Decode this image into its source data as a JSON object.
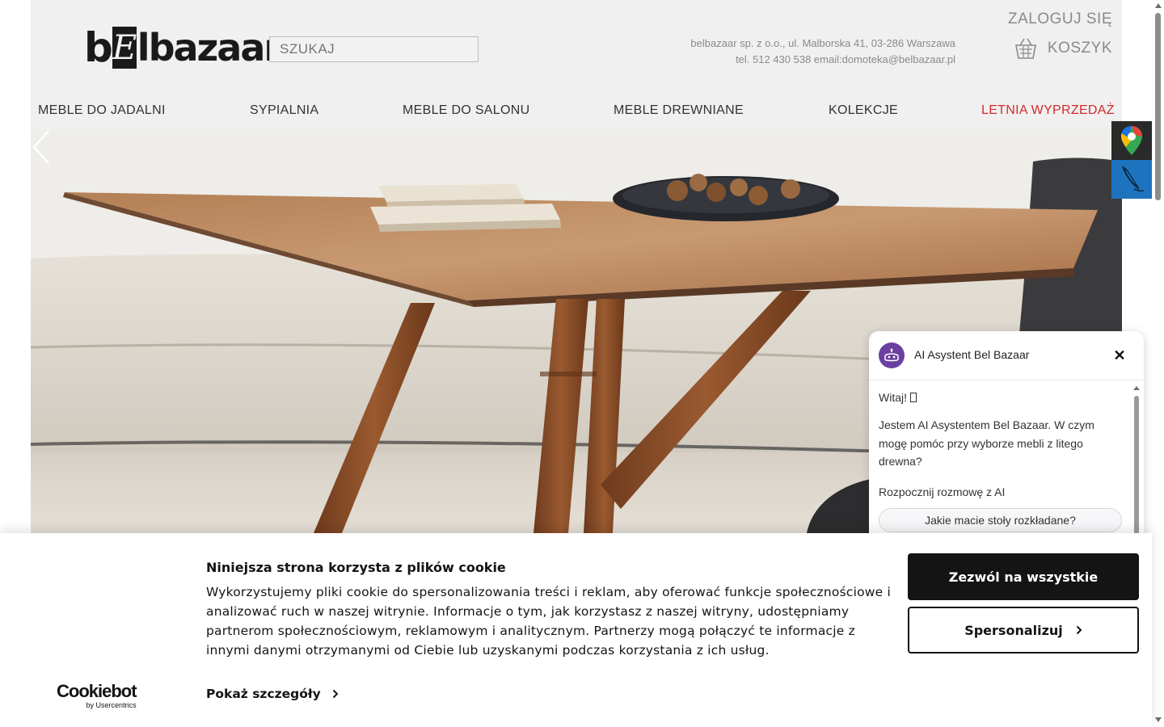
{
  "header": {
    "logo": {
      "b": "b",
      "e": "E",
      "rest": "lbazaar"
    },
    "search_placeholder": "SZUKAJ",
    "address_line1": "belbazaar sp. z o.o., ul. Malborska 41, 03-286 Warszawa",
    "address_line2": "tel. 512 430 538 email:domoteka@belbazaar.pl",
    "login": "ZALOGUJ SIĘ",
    "cart": "KOSZYK"
  },
  "nav": {
    "items": [
      {
        "label": "MEBLE DO JADALNI"
      },
      {
        "label": "SYPIALNIA"
      },
      {
        "label": "MEBLE DO SALONU"
      },
      {
        "label": "MEBLE DREWNIANE"
      },
      {
        "label": "KOLEKCJE"
      },
      {
        "label": "LETNIA WYPRZEDAŻ"
      }
    ]
  },
  "hero": {
    "prev_icon": "chevron-left-icon"
  },
  "side_widgets": {
    "map_icon": "google-maps-icon",
    "write_icon": "feather-pen-icon"
  },
  "chat": {
    "title": "AI Asystent Bel Bazaar",
    "close": "✕",
    "greeting": "Witaj! ",
    "message": "Jestem AI Asystentem Bel Bazaar. W czym mogę pomóc przy wyborze mebli z litego drewna?",
    "start": "Rozpocznij rozmowę z AI",
    "suggestion": "Jakie macie stoły rozkładane?"
  },
  "cookie": {
    "logo_main": "Cookiebot",
    "logo_sub": "by Usercentrics",
    "title": "Niniejsza strona korzysta z plików cookie",
    "text": "Wykorzystujemy pliki cookie do spersonalizowania treści i reklam, aby oferować funkcje społecznościowe i analizować ruch w naszej witrynie. Informacje o tym, jak korzystasz z naszej witryny, udostępniamy partnerom społecznościowym, reklamowym i analitycznym. Partnerzy mogą połączyć te informacje z innymi danymi otrzymanymi od Ciebie lub uzyskanymi podczas korzystania z ich usług.",
    "details": "Pokaż szczegóły",
    "allow_all": "Zezwól na wszystkie",
    "customize": "Spersonalizuj"
  },
  "colors": {
    "header_bg": "#f0f0f0",
    "sale": "#d42a2a",
    "chat_accent": "#6b3fa0",
    "write_widget": "#1e73be"
  }
}
